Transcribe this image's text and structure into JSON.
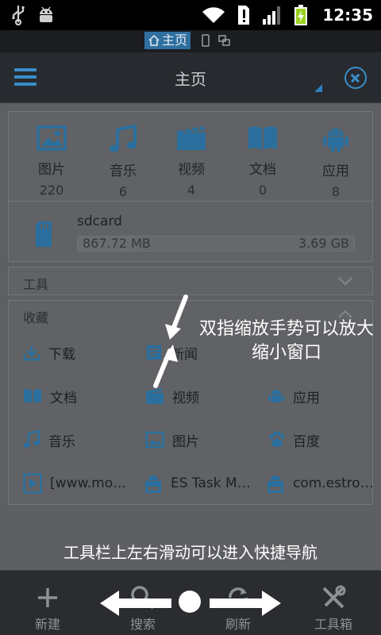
{
  "status_bar": {
    "time": "12:35"
  },
  "window_tabs": {
    "active": "主页"
  },
  "title_bar": {
    "title": "主页"
  },
  "categories": [
    {
      "label": "图片",
      "count": "220",
      "icon": "image-icon"
    },
    {
      "label": "音乐",
      "count": "6",
      "icon": "music-icon"
    },
    {
      "label": "视频",
      "count": "4",
      "icon": "video-icon"
    },
    {
      "label": "文档",
      "count": "0",
      "icon": "document-icon"
    },
    {
      "label": "应用",
      "count": "8",
      "icon": "android-icon"
    }
  ],
  "storage": {
    "name": "sdcard",
    "used": "867.72 MB",
    "total": "3.69 GB",
    "used_fraction": 0.23
  },
  "sections": {
    "tools": "工具",
    "favorites": "收藏"
  },
  "favorites": [
    {
      "label": "下载",
      "icon": "download-icon"
    },
    {
      "label": "新闻",
      "icon": "news-icon"
    },
    {
      "label": "文档",
      "icon": "document-icon"
    },
    {
      "label": "视频",
      "icon": "video-icon"
    },
    {
      "label": "应用",
      "icon": "android-icon"
    },
    {
      "label": "音乐",
      "icon": "music-icon"
    },
    {
      "label": "图片",
      "icon": "image-icon"
    },
    {
      "label": "百度",
      "icon": "baidu-paw-icon"
    },
    {
      "label": "[www.mo…",
      "icon": "video-file-icon"
    },
    {
      "label": "ES Task M…",
      "icon": "apk-icon"
    },
    {
      "label": "com.estro…",
      "icon": "apk-icon"
    }
  ],
  "hints": {
    "pinch": "双指缩放手势可以放大缩小窗口",
    "swipe": "工具栏上左右滑动可以进入快捷导航"
  },
  "toolbar": [
    {
      "label": "新建",
      "icon": "plus-icon"
    },
    {
      "label": "搜索",
      "icon": "search-icon"
    },
    {
      "label": "刷新",
      "icon": "refresh-icon"
    },
    {
      "label": "工具箱",
      "icon": "tools-icon"
    }
  ],
  "colors": {
    "accent": "#3a8dc8",
    "overlay": "#5d5f62"
  }
}
